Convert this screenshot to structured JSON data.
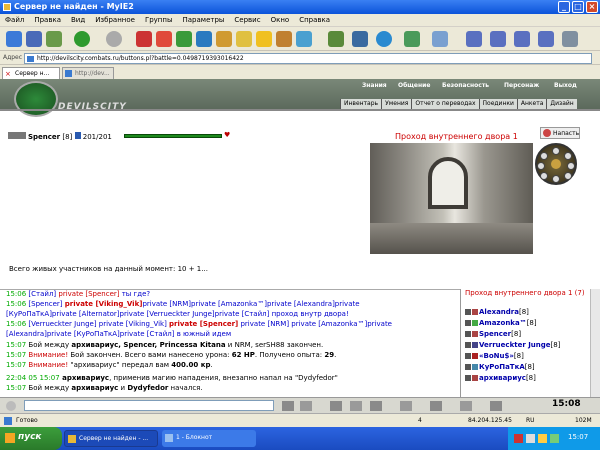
{
  "window": {
    "title": "Сервер не найден - MyIE2"
  },
  "menu": [
    "Файл",
    "Правка",
    "Вид",
    "Избранное",
    "Группы",
    "Параметры",
    "Сервис",
    "Окно",
    "Справка"
  ],
  "address": {
    "label": "Адрес",
    "url": "http://devilscity.combats.ru/buttons.pl?battle=0.0498719393016422"
  },
  "tabs": [
    {
      "label": "Сервер н..."
    },
    {
      "label": "http://dev..."
    }
  ],
  "site": {
    "brand": "DEVILSCITY",
    "topnav": [
      "Знания",
      "Общение",
      "Безопасность",
      "Персонаж",
      "Выход"
    ],
    "subnav": [
      "Инвентарь",
      "Умения",
      "Отчет о переводах",
      "Поединки",
      "Анкета",
      "Дизайн"
    ]
  },
  "player": {
    "name": "Spencer",
    "level": "[8]",
    "hp": "201/201"
  },
  "location": {
    "title": "Проход внутреннего двора 1",
    "attack_label": "Напасть"
  },
  "alive": "Всего живых участников на данный момент: 10 + 1...",
  "chat": {
    "l0": {
      "a": "15:06",
      "b": " [Стайл] ",
      "c": "private [Spencer]",
      "d": " ты где?"
    },
    "l1": {
      "a": "15:06",
      "b": " [Spencer] ",
      "c": "private [Viking_Vik]",
      "d": "private [NRM]private [Amazonka™]private [Alexandra]private"
    },
    "l2": {
      "a": "[КуРоПаТкА]private [Alternator]private [Verrueckter Junge]private [Стайл] проход внутр двора!"
    },
    "l3": {
      "a": "15:06",
      "b": " [Verrueckter Junge] ",
      "c": "private [Viking_Vik] ",
      "d": "private [Spencer]",
      "e": " private [NRM] private [Amazonka™]private"
    },
    "l4": {
      "a": "[Alexandra]private [КуРоПаТкА]private [Стайл] в южный идем"
    },
    "l5": {
      "a": "15:07",
      "b": " Бой между ",
      "c": "архивариус, Spencer, Princessa Kitana",
      "d": " и NRM, serSH88 закончен."
    },
    "l6": {
      "a": "15:07",
      "b": " Внимание!",
      "c": " Бой закончен. Всего вами нанесено урона: ",
      "d": "62 HP",
      "e": ". Получено опыта: ",
      "f": "29",
      "g": "."
    },
    "l7": {
      "a": "15:07",
      "b": " Внимание!",
      "c": " \"архивариус\" передал вам ",
      "d": "400.00 кр",
      "e": "."
    },
    "l8": {
      "a": "22:04 05 15:07",
      "b": " архивариус",
      "c": ", применив магию нападения, внезапно напал на \"Dydyfedor\""
    },
    "l9": {
      "a": "15:07",
      "b": " Бой между ",
      "c": "архивариус",
      "d": " и ",
      "e": "Dydyfedor",
      "f": " начался."
    }
  },
  "side": {
    "title": "Проход внутреннего двора 1 (7)",
    "players": [
      {
        "name": "Alexandra",
        "lvl": "[8]"
      },
      {
        "name": "Amazonka™",
        "lvl": "[8]"
      },
      {
        "name": "Spencer",
        "lvl": "[8]"
      },
      {
        "name": "Verrueckter Junge",
        "lvl": "[8]"
      },
      {
        "name": "«BoNu$»",
        "lvl": "[8]"
      },
      {
        "name": "КуРоПаТкА",
        "lvl": "[8]"
      },
      {
        "name": "архивариус",
        "lvl": "[8]"
      }
    ]
  },
  "clock": "15:08",
  "status": {
    "text": "Готово",
    "count": "4",
    "ip": "84.204.125.45",
    "lang": "RU",
    "mem": "102M"
  },
  "taskbar": {
    "start": "пуск",
    "t1": "Сервер не найден - ...",
    "t2": "1 - Блокнот",
    "time": "15:07"
  },
  "colors": {
    "title": "#0b53d9",
    "location": "#cc0000",
    "hp": "#1e8a1e"
  }
}
